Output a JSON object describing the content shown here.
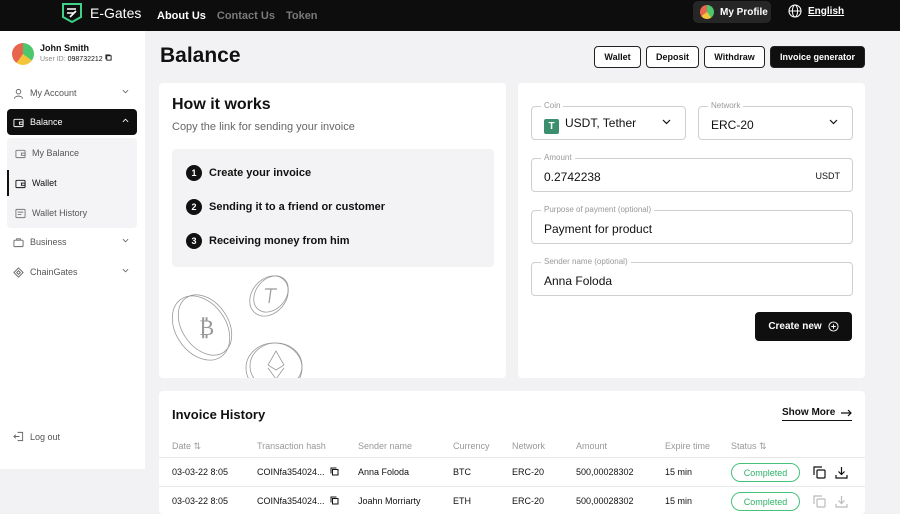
{
  "header": {
    "brand": "E-Gates",
    "nav": [
      "About Us",
      "Contact Us",
      "Token"
    ],
    "profile_label": "My Profile",
    "language": "English"
  },
  "sidebar": {
    "user_name": "John Smith",
    "user_id_label": "User ID:",
    "user_id": "098732212",
    "items": {
      "account": "My Account",
      "balance": "Balance",
      "my_balance": "My Balance",
      "wallet": "Wallet",
      "wallet_history": "Wallet History",
      "business": "Business",
      "chaingates": "ChainGates"
    },
    "logout": "Log out"
  },
  "page": {
    "title": "Balance",
    "buttons": [
      "Wallet",
      "Deposit",
      "Withdraw",
      "Invoice generator"
    ]
  },
  "how_it_works": {
    "title": "How it works",
    "subtitle": "Copy the link for sending your invoice",
    "steps": [
      {
        "num": "1",
        "text": "Create your invoice"
      },
      {
        "num": "2",
        "text": "Sending it to a friend or customer"
      },
      {
        "num": "3",
        "text": "Receiving money from him"
      }
    ]
  },
  "form": {
    "coin": {
      "label": "Coin",
      "value": "USDT, Tether",
      "icon": "T"
    },
    "network": {
      "label": "Network",
      "value": "ERC-20"
    },
    "amount": {
      "label": "Amount",
      "value": "0.2742238",
      "unit": "USDT"
    },
    "purpose": {
      "label": "Purpose of payment (optional)",
      "value": "Payment for product"
    },
    "sender": {
      "label": "Sender name (optional)",
      "value": "Anna Foloda"
    },
    "create_label": "Create new"
  },
  "invoice_history": {
    "title": "Invoice History",
    "show_more": "Show More",
    "columns": [
      "Date",
      "Transaction hash",
      "Sender name",
      "Currency",
      "Network",
      "Amount",
      "Expire time",
      "Status"
    ],
    "rows": [
      {
        "date": "03-03-22 8:05",
        "hash": "COINfa354024...",
        "sender": "Anna Foloda",
        "currency": "BTC",
        "network": "ERC-20",
        "amount": "500,00028302",
        "expire": "15 min",
        "status": "Completed"
      },
      {
        "date": "03-03-22 8:05",
        "hash": "COINfa354024...",
        "sender": "Joahn Morriarty",
        "currency": "ETH",
        "network": "ERC-20",
        "amount": "500,00028302",
        "expire": "15 min",
        "status": "Completed"
      }
    ]
  }
}
